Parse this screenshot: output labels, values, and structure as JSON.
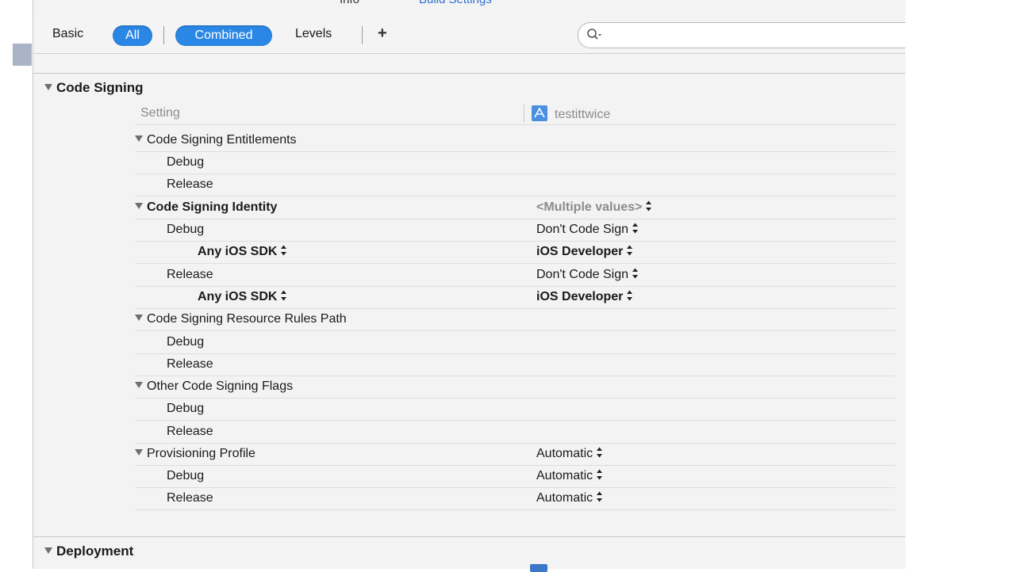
{
  "top_tabs": {
    "info": "Info",
    "build_settings": "Build Settings"
  },
  "filterbar": {
    "basic": "Basic",
    "all": "All",
    "combined": "Combined",
    "levels": "Levels",
    "add": "+",
    "search_placeholder": ""
  },
  "sections": {
    "code_signing": "Code Signing",
    "deployment": "Deployment"
  },
  "header": {
    "setting": "Setting",
    "target": "testittwice"
  },
  "rows": {
    "entitlements": {
      "label": "Code Signing Entitlements",
      "debug": "Debug",
      "release": "Release"
    },
    "identity": {
      "label": "Code Signing Identity",
      "value": "<Multiple values>",
      "debug": "Debug",
      "debug_value": "Don't Code Sign",
      "debug_sdk": "Any iOS SDK",
      "debug_sdk_value": "iOS Developer",
      "release": "Release",
      "release_value": "Don't Code Sign",
      "release_sdk": "Any iOS SDK",
      "release_sdk_value": "iOS Developer"
    },
    "rules": {
      "label": "Code Signing Resource Rules Path",
      "debug": "Debug",
      "release": "Release"
    },
    "flags": {
      "label": "Other Code Signing Flags",
      "debug": "Debug",
      "release": "Release"
    },
    "profile": {
      "label": "Provisioning Profile",
      "value": "Automatic",
      "debug": "Debug",
      "debug_value": "Automatic",
      "release": "Release",
      "release_value": "Automatic"
    }
  },
  "colors": {
    "accent": "#2b87e6",
    "link": "#2f6fd3",
    "background": "#f3f3f3"
  }
}
